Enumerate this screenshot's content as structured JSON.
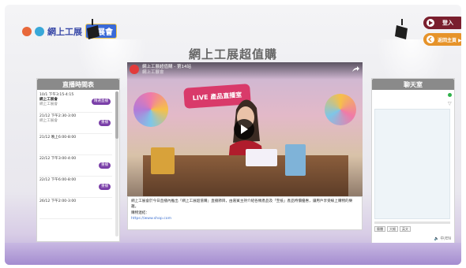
{
  "header": {
    "logo_text": "網上工展",
    "logo_badge": "工展會",
    "page_title": "網上工展超值購",
    "login_label": "登入",
    "back_label": "返回主頁 ▶"
  },
  "schedule": {
    "title": "直播時間表",
    "items": [
      {
        "time": "10/1 下午3:15-4:15",
        "title": "網上工展會",
        "host": "網上工展會",
        "button": "精選直播"
      },
      {
        "time": "21/12 下午2:30-3:00",
        "title": "",
        "host": "網上工展會",
        "button": "重播"
      },
      {
        "time": "21/12 晚上6:00-8:00",
        "title": "",
        "host": "",
        "button": ""
      },
      {
        "time": "22/12 下午3:00-4:00",
        "title": "",
        "host": "",
        "button": "重播"
      },
      {
        "time": "22/12 下午6:00-8:00",
        "title": "",
        "host": "",
        "button": "重播"
      },
      {
        "time": "26/12 下午2:00-3:00",
        "title": "",
        "host": "",
        "button": ""
      }
    ]
  },
  "video": {
    "channel_title": "網上工展超值購 - 第14站",
    "channel_sub": "網上工展會",
    "live_badge": "LIVE 產品直播室"
  },
  "description": {
    "text": "網上工展會於今日直播內推出「網上工展超值購」直播節目，由嘉賓主持介紹各類產品及「至抵」產品特價優惠，讓用戶享受線上購物的樂趣。",
    "shop_label": "購物連結：",
    "shop_link": "https://www.shop.com"
  },
  "chat": {
    "title": "聊天室",
    "controls": [
      "簡體",
      "大細",
      "英文"
    ],
    "extra": "🔈 中/EN"
  },
  "colors": {
    "login": "#7a1f2e",
    "back": "#e6932a",
    "schedule_button": "#7a3fa8",
    "header_bar": "#8a8a8a"
  }
}
